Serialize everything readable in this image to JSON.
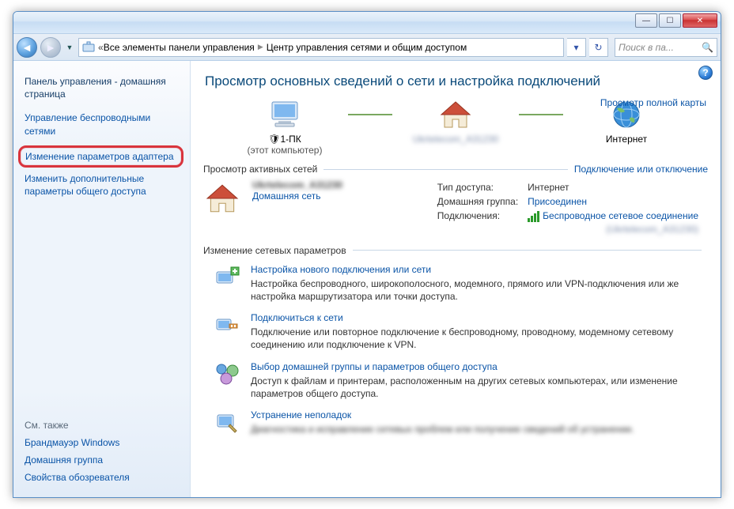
{
  "window": {
    "breadcrumb_root": "Все элементы панели управления",
    "breadcrumb_current": "Центр управления сетями и общим доступом",
    "search_placeholder": "Поиск в па..."
  },
  "sidebar": {
    "home": "Панель управления - домашняя страница",
    "tasks": {
      "wireless": "Управление беспроводными сетями",
      "adapter": "Изменение параметров адаптера",
      "sharing": "Изменить дополнительные параметры общего доступа"
    },
    "see_also_head": "См. также",
    "see_also": {
      "firewall": "Брандмауэр Windows",
      "homegroup": "Домашняя группа",
      "ie_options": "Свойства обозревателя"
    }
  },
  "main": {
    "title": "Просмотр основных сведений о сети и настройка подключений",
    "map": {
      "pc_name": "1-ПК",
      "pc_sub": "(этот компьютер)",
      "router_name": "Ukrtelecom_A31230",
      "internet": "Интернет",
      "full_map": "Просмотр полной карты"
    },
    "active_head": "Просмотр активных сетей",
    "active_right": "Подключение или отключение",
    "active": {
      "name": "Ukrtelecom_A31230",
      "type": "Домашняя сеть",
      "access_label": "Тип доступа:",
      "access_value": "Интернет",
      "homegroup_label": "Домашняя группа:",
      "homegroup_value": "Присоединен",
      "conn_label": "Подключения:",
      "conn_value": "Беспроводное сетевое соединение",
      "conn_ssid": "(Ukrtelecom_A31230)"
    },
    "change_head": "Изменение сетевых параметров",
    "tasks": {
      "new_conn": {
        "title": "Настройка нового подключения или сети",
        "desc": "Настройка беспроводного, широкополосного, модемного, прямого или VPN-подключения или же настройка маршрутизатора или точки доступа."
      },
      "connect": {
        "title": "Подключиться к сети",
        "desc": "Подключение или повторное подключение к беспроводному, проводному, модемному сетевому соединению или подключение к VPN."
      },
      "homegroup": {
        "title": "Выбор домашней группы и параметров общего доступа",
        "desc": "Доступ к файлам и принтерам, расположенным на других сетевых компьютерах, или изменение параметров общего доступа."
      },
      "troubleshoot": {
        "title": "Устранение неполадок",
        "desc": "Диагностика и исправление сетевых проблем или получение сведений об устранении."
      }
    }
  }
}
